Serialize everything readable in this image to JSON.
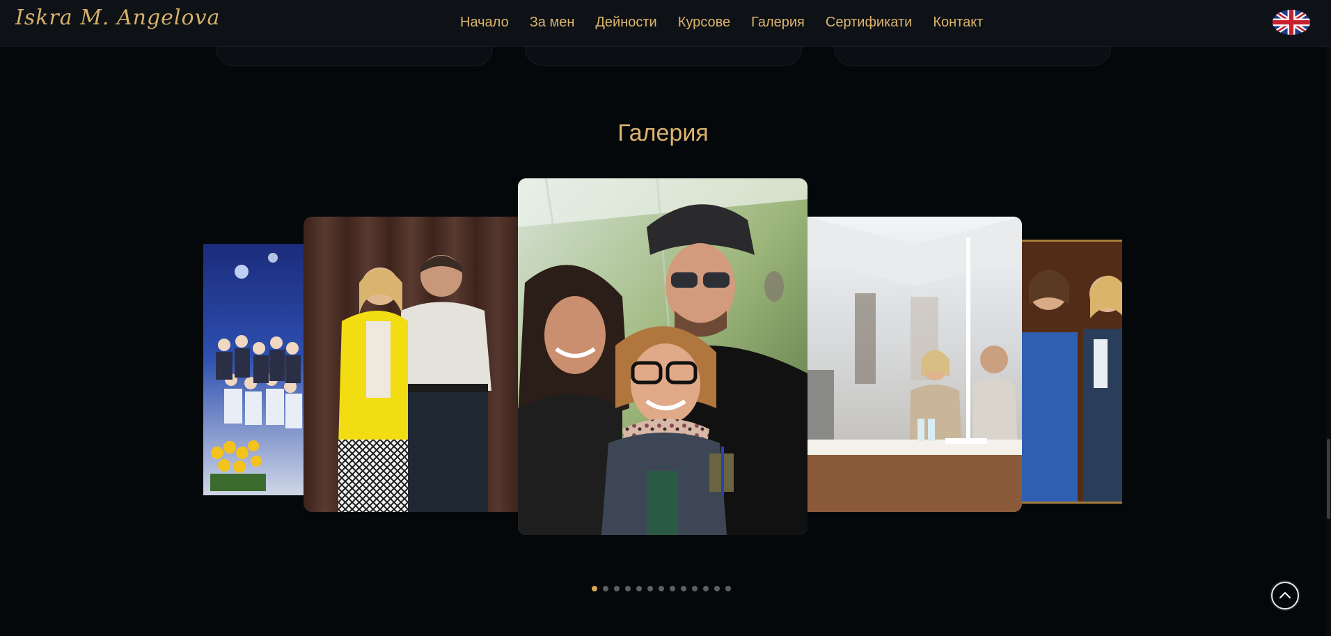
{
  "header": {
    "logo_text": "Iskra M. Angelova",
    "nav": [
      {
        "label": "Начало"
      },
      {
        "label": "За мен"
      },
      {
        "label": "Дейности"
      },
      {
        "label": "Курсове"
      },
      {
        "label": "Галерия"
      },
      {
        "label": "Сертификати"
      },
      {
        "label": "Контакт"
      }
    ],
    "language_icon": "uk-flag-icon"
  },
  "gallery": {
    "title": "Галерия",
    "slides": [
      {
        "name": "group-stage-photo"
      },
      {
        "name": "yellow-blazer-couple-photo"
      },
      {
        "name": "three-friends-selfie-photo"
      },
      {
        "name": "outdoor-tent-table-photo"
      },
      {
        "name": "blue-suit-women-photo"
      }
    ],
    "pagination_count": 13,
    "active_index": 0
  },
  "back_to_top_icon": "chevron-up-icon",
  "colors": {
    "background": "#05080b",
    "header": "#0e1216",
    "accent_gold": "#dcb46d",
    "active_dot": "#d8aa57",
    "inactive_dot": "#5c5f63"
  }
}
